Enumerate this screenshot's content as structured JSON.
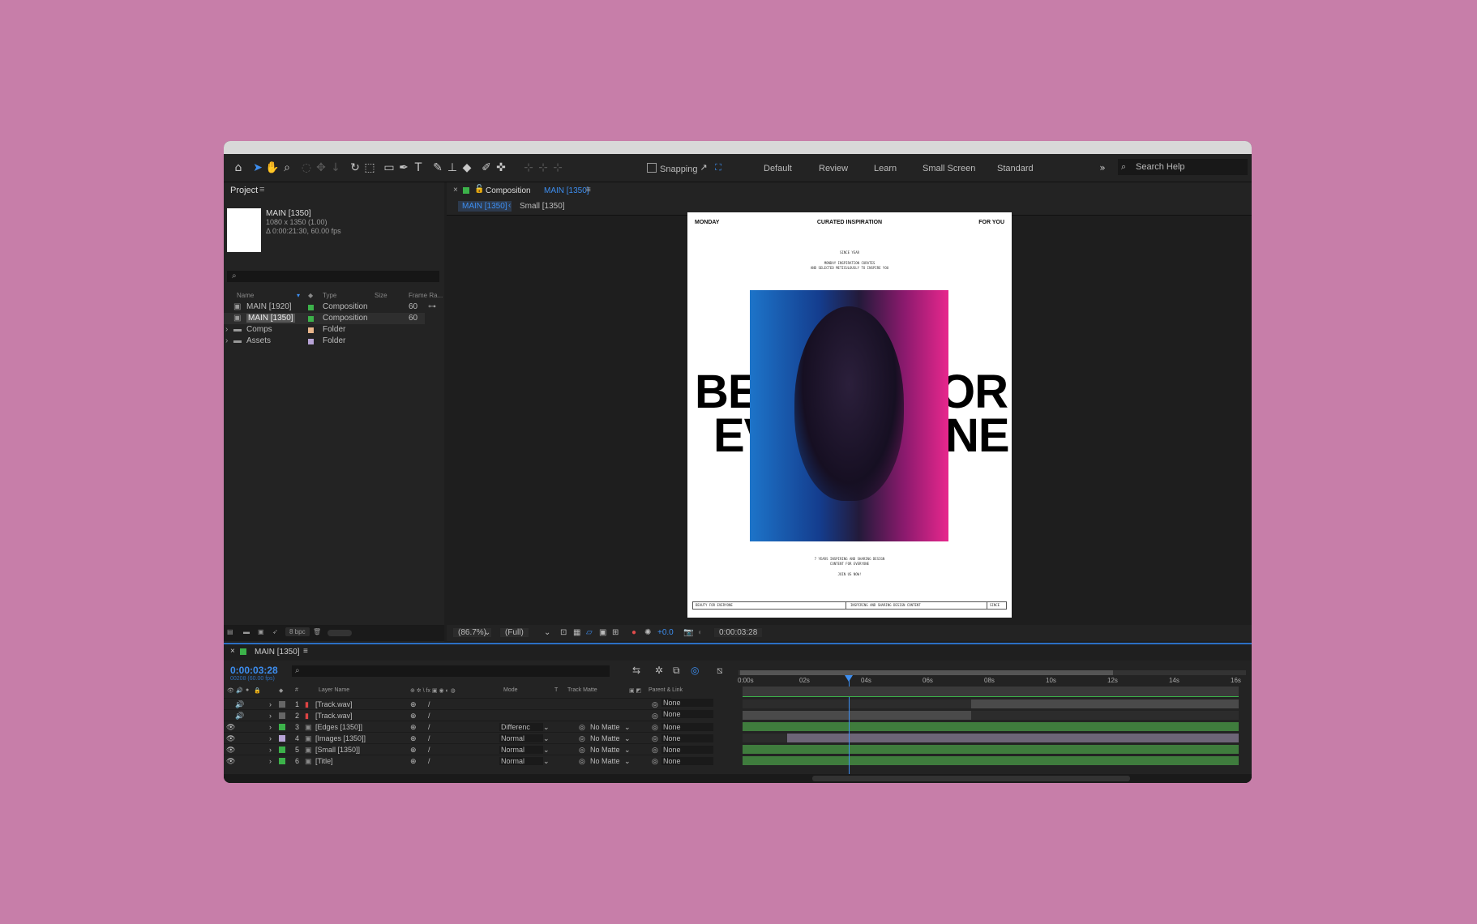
{
  "toolbar": {
    "snapping_label": "Snapping",
    "workspaces": [
      "Default",
      "Review",
      "Learn",
      "Small Screen",
      "Standard"
    ],
    "search_help": "Search Help",
    "icons": [
      "home-icon",
      "selection-arrow-icon",
      "hand-icon",
      "zoom-icon",
      "orbit-icon",
      "pan-icon",
      "dolly-icon",
      "rotate-icon",
      "anchor-icon",
      "rectangle-icon",
      "pen-icon",
      "type-icon",
      "brush-icon",
      "clone-stamp-icon",
      "eraser-icon",
      "roto-brush-icon",
      "puppet-pin-icon"
    ]
  },
  "project": {
    "title": "Project",
    "selected_name": "MAIN [1350]",
    "selected_dims": "1080 x 1350 (1.00)",
    "selected_duration": "Δ 0:00:21:30, 60.00 fps",
    "search_placeholder": "",
    "columns": {
      "name": "Name",
      "type": "Type",
      "size": "Size",
      "frame_rate": "Frame Ra..."
    },
    "items": [
      {
        "name": "MAIN [1920]",
        "type": "Composition",
        "size": "",
        "rate": "60",
        "color": "#3cb24a"
      },
      {
        "name": "MAIN [1350]",
        "type": "Composition",
        "size": "",
        "rate": "60",
        "color": "#3cb24a"
      },
      {
        "name": "Comps",
        "type": "Folder",
        "size": "",
        "rate": "",
        "color": "#e8b58b"
      },
      {
        "name": "Assets",
        "type": "Folder",
        "size": "",
        "rate": "",
        "color": "#b7a3d6"
      }
    ],
    "bpc": "8 bpc"
  },
  "composition": {
    "tab_prefix": "Composition",
    "tab_name": "MAIN [1350]",
    "subtabs": [
      "MAIN [1350]",
      "Small [1350]"
    ],
    "zoom": "(86.7%)",
    "resolution": "(Full)",
    "exposure": "+0.0",
    "timecode": "0:00:03:28",
    "artboard": {
      "left": "MONDAY",
      "center": "CURATED INSPIRATION",
      "right": "FOR YOU",
      "since": "SINCE YEAR",
      "intro_1": "MONDAY INSPIRATION CURATES",
      "intro_2": "AND SELECTED METICULOUSLY TO INSPIRE YOU",
      "big_1_left": "BE",
      "big_1_right": "OR",
      "big_2_left": "EV",
      "big_2_right": "NE",
      "outro_1": "7 YEARS INSPIRING AND SHARING DESIGN",
      "outro_2": "CONTENT FOR EVERYONE",
      "join": "JOIN US NOW!",
      "footer_1": "BEAUTY FOR EVERYONE",
      "footer_2": "INSPIRING AND SHARING DESIGN CONTENT",
      "footer_3": "SINCE"
    }
  },
  "timeline": {
    "comp_name": "MAIN [1350]",
    "timecode": "0:00:03:28",
    "frames": "00208 (60.00 fps)",
    "columns": {
      "layer_name": "Layer Name",
      "mode": "Mode",
      "t": "T",
      "track_matte": "Track Matte",
      "parent": "Parent & Link",
      "hash": "#"
    },
    "ruler": [
      "0:00s",
      "02s",
      "04s",
      "06s",
      "08s",
      "10s",
      "12s",
      "14s",
      "16s"
    ],
    "layers": [
      {
        "num": "1",
        "name": "[Track.wav]",
        "mode": "",
        "matte": "",
        "parent": "None",
        "color": "#666666",
        "bar_start": 0.46,
        "bar_color": "#4a4a4a"
      },
      {
        "num": "2",
        "name": "[Track.wav]",
        "mode": "",
        "matte": "",
        "parent": "None",
        "color": "#666666",
        "bar_start": 0.0,
        "bar_end": 0.46,
        "bar_color": "#4a4a4a"
      },
      {
        "num": "3",
        "name": "[Edges [1350]]",
        "mode": "Differenc",
        "matte": "No Matte",
        "parent": "None",
        "color": "#3cb24a",
        "bar_start": 0.0,
        "bar_color": "#3f7c3d"
      },
      {
        "num": "4",
        "name": "[Images [1350]]",
        "mode": "Normal",
        "matte": "No Matte",
        "parent": "None",
        "color": "#b7a3d6",
        "bar_start": 0.09,
        "bar_color": "#6d6577"
      },
      {
        "num": "5",
        "name": "[Small [1350]]",
        "mode": "Normal",
        "matte": "No Matte",
        "parent": "None",
        "color": "#3cb24a",
        "bar_start": 0.0,
        "bar_color": "#3f7c3d"
      },
      {
        "num": "6",
        "name": "[Title]",
        "mode": "Normal",
        "matte": "No Matte",
        "parent": "None",
        "color": "#3cb24a",
        "bar_start": 0.0,
        "bar_color": "#3f7c3d"
      }
    ]
  }
}
